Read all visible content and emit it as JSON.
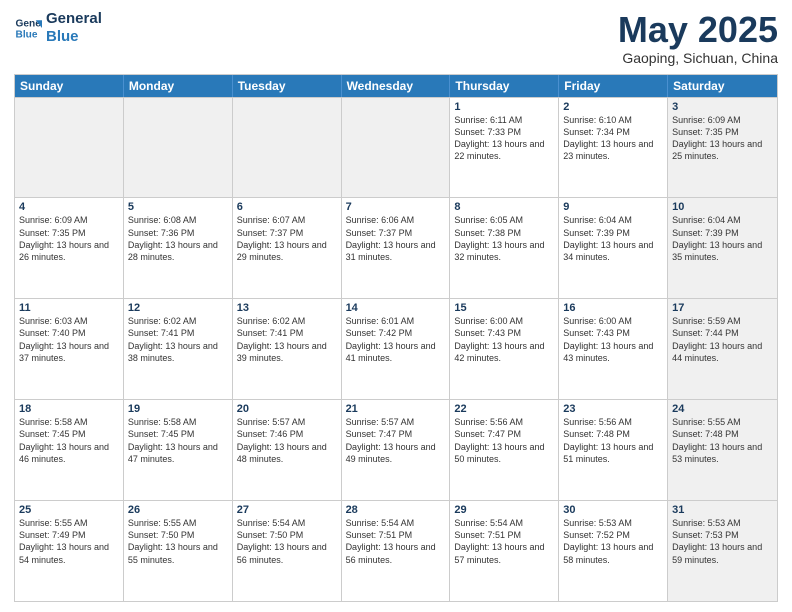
{
  "header": {
    "logo_line1": "General",
    "logo_line2": "Blue",
    "month": "May 2025",
    "location": "Gaoping, Sichuan, China"
  },
  "days_of_week": [
    "Sunday",
    "Monday",
    "Tuesday",
    "Wednesday",
    "Thursday",
    "Friday",
    "Saturday"
  ],
  "rows": [
    [
      {
        "day": "",
        "info": "",
        "shaded": true
      },
      {
        "day": "",
        "info": "",
        "shaded": true
      },
      {
        "day": "",
        "info": "",
        "shaded": true
      },
      {
        "day": "",
        "info": "",
        "shaded": true
      },
      {
        "day": "1",
        "sunrise": "Sunrise: 6:11 AM",
        "sunset": "Sunset: 7:33 PM",
        "daylight": "Daylight: 13 hours and 22 minutes.",
        "shaded": false
      },
      {
        "day": "2",
        "sunrise": "Sunrise: 6:10 AM",
        "sunset": "Sunset: 7:34 PM",
        "daylight": "Daylight: 13 hours and 23 minutes.",
        "shaded": false
      },
      {
        "day": "3",
        "sunrise": "Sunrise: 6:09 AM",
        "sunset": "Sunset: 7:35 PM",
        "daylight": "Daylight: 13 hours and 25 minutes.",
        "shaded": true
      }
    ],
    [
      {
        "day": "4",
        "sunrise": "Sunrise: 6:09 AM",
        "sunset": "Sunset: 7:35 PM",
        "daylight": "Daylight: 13 hours and 26 minutes.",
        "shaded": false
      },
      {
        "day": "5",
        "sunrise": "Sunrise: 6:08 AM",
        "sunset": "Sunset: 7:36 PM",
        "daylight": "Daylight: 13 hours and 28 minutes.",
        "shaded": false
      },
      {
        "day": "6",
        "sunrise": "Sunrise: 6:07 AM",
        "sunset": "Sunset: 7:37 PM",
        "daylight": "Daylight: 13 hours and 29 minutes.",
        "shaded": false
      },
      {
        "day": "7",
        "sunrise": "Sunrise: 6:06 AM",
        "sunset": "Sunset: 7:37 PM",
        "daylight": "Daylight: 13 hours and 31 minutes.",
        "shaded": false
      },
      {
        "day": "8",
        "sunrise": "Sunrise: 6:05 AM",
        "sunset": "Sunset: 7:38 PM",
        "daylight": "Daylight: 13 hours and 32 minutes.",
        "shaded": false
      },
      {
        "day": "9",
        "sunrise": "Sunrise: 6:04 AM",
        "sunset": "Sunset: 7:39 PM",
        "daylight": "Daylight: 13 hours and 34 minutes.",
        "shaded": false
      },
      {
        "day": "10",
        "sunrise": "Sunrise: 6:04 AM",
        "sunset": "Sunset: 7:39 PM",
        "daylight": "Daylight: 13 hours and 35 minutes.",
        "shaded": true
      }
    ],
    [
      {
        "day": "11",
        "sunrise": "Sunrise: 6:03 AM",
        "sunset": "Sunset: 7:40 PM",
        "daylight": "Daylight: 13 hours and 37 minutes.",
        "shaded": false
      },
      {
        "day": "12",
        "sunrise": "Sunrise: 6:02 AM",
        "sunset": "Sunset: 7:41 PM",
        "daylight": "Daylight: 13 hours and 38 minutes.",
        "shaded": false
      },
      {
        "day": "13",
        "sunrise": "Sunrise: 6:02 AM",
        "sunset": "Sunset: 7:41 PM",
        "daylight": "Daylight: 13 hours and 39 minutes.",
        "shaded": false
      },
      {
        "day": "14",
        "sunrise": "Sunrise: 6:01 AM",
        "sunset": "Sunset: 7:42 PM",
        "daylight": "Daylight: 13 hours and 41 minutes.",
        "shaded": false
      },
      {
        "day": "15",
        "sunrise": "Sunrise: 6:00 AM",
        "sunset": "Sunset: 7:43 PM",
        "daylight": "Daylight: 13 hours and 42 minutes.",
        "shaded": false
      },
      {
        "day": "16",
        "sunrise": "Sunrise: 6:00 AM",
        "sunset": "Sunset: 7:43 PM",
        "daylight": "Daylight: 13 hours and 43 minutes.",
        "shaded": false
      },
      {
        "day": "17",
        "sunrise": "Sunrise: 5:59 AM",
        "sunset": "Sunset: 7:44 PM",
        "daylight": "Daylight: 13 hours and 44 minutes.",
        "shaded": true
      }
    ],
    [
      {
        "day": "18",
        "sunrise": "Sunrise: 5:58 AM",
        "sunset": "Sunset: 7:45 PM",
        "daylight": "Daylight: 13 hours and 46 minutes.",
        "shaded": false
      },
      {
        "day": "19",
        "sunrise": "Sunrise: 5:58 AM",
        "sunset": "Sunset: 7:45 PM",
        "daylight": "Daylight: 13 hours and 47 minutes.",
        "shaded": false
      },
      {
        "day": "20",
        "sunrise": "Sunrise: 5:57 AM",
        "sunset": "Sunset: 7:46 PM",
        "daylight": "Daylight: 13 hours and 48 minutes.",
        "shaded": false
      },
      {
        "day": "21",
        "sunrise": "Sunrise: 5:57 AM",
        "sunset": "Sunset: 7:47 PM",
        "daylight": "Daylight: 13 hours and 49 minutes.",
        "shaded": false
      },
      {
        "day": "22",
        "sunrise": "Sunrise: 5:56 AM",
        "sunset": "Sunset: 7:47 PM",
        "daylight": "Daylight: 13 hours and 50 minutes.",
        "shaded": false
      },
      {
        "day": "23",
        "sunrise": "Sunrise: 5:56 AM",
        "sunset": "Sunset: 7:48 PM",
        "daylight": "Daylight: 13 hours and 51 minutes.",
        "shaded": false
      },
      {
        "day": "24",
        "sunrise": "Sunrise: 5:55 AM",
        "sunset": "Sunset: 7:48 PM",
        "daylight": "Daylight: 13 hours and 53 minutes.",
        "shaded": true
      }
    ],
    [
      {
        "day": "25",
        "sunrise": "Sunrise: 5:55 AM",
        "sunset": "Sunset: 7:49 PM",
        "daylight": "Daylight: 13 hours and 54 minutes.",
        "shaded": false
      },
      {
        "day": "26",
        "sunrise": "Sunrise: 5:55 AM",
        "sunset": "Sunset: 7:50 PM",
        "daylight": "Daylight: 13 hours and 55 minutes.",
        "shaded": false
      },
      {
        "day": "27",
        "sunrise": "Sunrise: 5:54 AM",
        "sunset": "Sunset: 7:50 PM",
        "daylight": "Daylight: 13 hours and 56 minutes.",
        "shaded": false
      },
      {
        "day": "28",
        "sunrise": "Sunrise: 5:54 AM",
        "sunset": "Sunset: 7:51 PM",
        "daylight": "Daylight: 13 hours and 56 minutes.",
        "shaded": false
      },
      {
        "day": "29",
        "sunrise": "Sunrise: 5:54 AM",
        "sunset": "Sunset: 7:51 PM",
        "daylight": "Daylight: 13 hours and 57 minutes.",
        "shaded": false
      },
      {
        "day": "30",
        "sunrise": "Sunrise: 5:53 AM",
        "sunset": "Sunset: 7:52 PM",
        "daylight": "Daylight: 13 hours and 58 minutes.",
        "shaded": false
      },
      {
        "day": "31",
        "sunrise": "Sunrise: 5:53 AM",
        "sunset": "Sunset: 7:53 PM",
        "daylight": "Daylight: 13 hours and 59 minutes.",
        "shaded": true
      }
    ]
  ]
}
